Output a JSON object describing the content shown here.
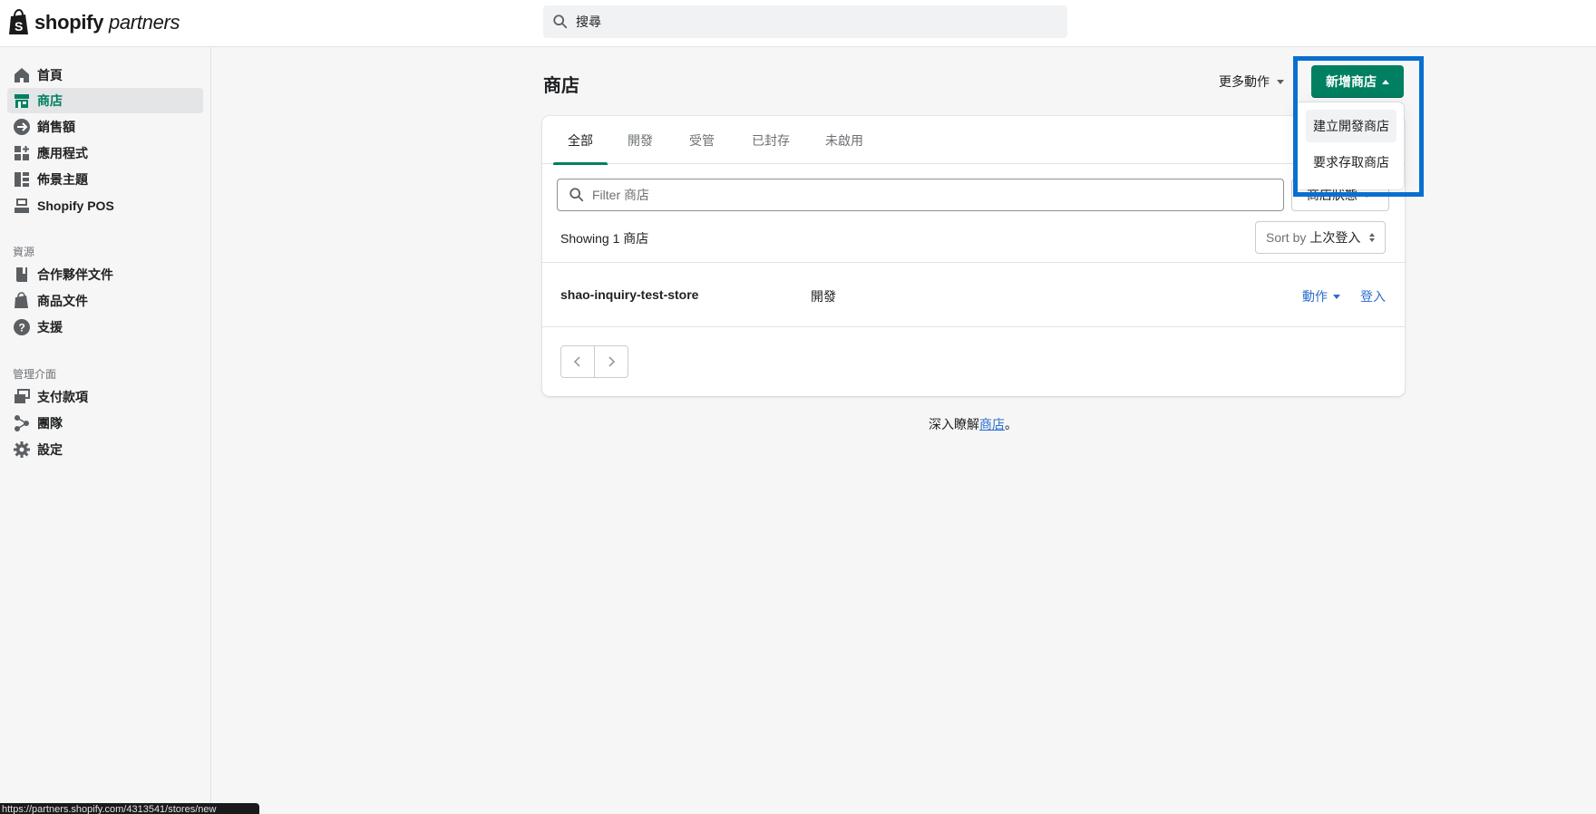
{
  "brand": {
    "bold": "shopify",
    "italic": "partners"
  },
  "search": {
    "placeholder": "搜尋"
  },
  "sidebar": {
    "items": [
      {
        "label": "首頁",
        "icon": "home-icon",
        "active": false
      },
      {
        "label": "商店",
        "icon": "store-icon",
        "active": true
      },
      {
        "label": "銷售額",
        "icon": "sales-icon",
        "active": false
      },
      {
        "label": "應用程式",
        "icon": "apps-icon",
        "active": false
      },
      {
        "label": "佈景主題",
        "icon": "themes-icon",
        "active": false
      },
      {
        "label": "Shopify POS",
        "icon": "pos-icon",
        "active": false
      }
    ],
    "resources_heading": "資源",
    "resources": [
      {
        "label": "合作夥伴文件",
        "icon": "book-icon"
      },
      {
        "label": "商品文件",
        "icon": "shopify-bag-icon"
      },
      {
        "label": "支援",
        "icon": "help-icon"
      }
    ],
    "admin_heading": "管理介面",
    "admin": [
      {
        "label": "支付款項",
        "icon": "payouts-icon"
      },
      {
        "label": "團隊",
        "icon": "team-icon"
      },
      {
        "label": "設定",
        "icon": "gear-icon"
      }
    ]
  },
  "page": {
    "title": "商店",
    "more_actions": "更多動作",
    "add_store": "新增商店",
    "dropdown": [
      "建立開發商店",
      "要求存取商店"
    ],
    "tabs": [
      "全部",
      "開發",
      "受管",
      "已封存",
      "未啟用"
    ],
    "filter_placeholder": "Filter 商店",
    "status_filter": "商店狀態",
    "showing": "Showing 1 商店",
    "sort_key": "Sort by",
    "sort_value": "上次登入",
    "stores": [
      {
        "name": "shao-inquiry-test-store",
        "type": "開發",
        "action": "動作",
        "login": "登入"
      }
    ],
    "learn_prefix": "深入瞭解",
    "learn_link": "商店",
    "learn_suffix": "。"
  },
  "status_bar": {
    "url": "https://partners.shopify.com/4313541/stores/new"
  }
}
